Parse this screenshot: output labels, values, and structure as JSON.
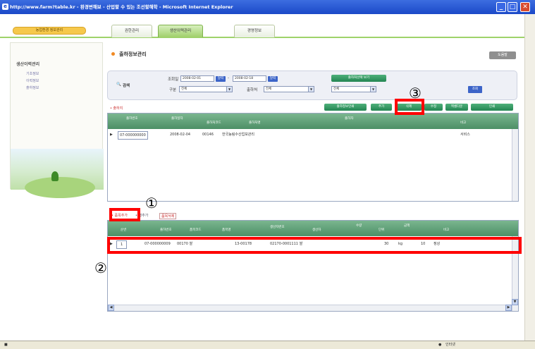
{
  "window": {
    "title": "http://www.farm?table.kr - 환경변해보 - 산업할 수 있는 조선할해학 - Microsoft Internet Explorer",
    "min": "_",
    "max": "□",
    "close": "✕"
  },
  "app": {
    "logo_text": "농업환경 정보관리",
    "tabs": [
      "권한관리",
      "생산이력관리",
      "경영정보"
    ],
    "active_tab_index": 1
  },
  "sidebar": {
    "heading": "생산이력관리",
    "items": [
      "기초정보",
      "이력정보",
      "출하정보"
    ]
  },
  "main": {
    "title": "출하정보관리",
    "top_right_button": "도움말",
    "search": {
      "label": "검색",
      "date_label": "조회일",
      "date_from": "2008-02-01",
      "date_to": "2008-02-18",
      "cal_btn": "달력",
      "type_label": "구분",
      "type_value": "전체",
      "dest_label": "출하처",
      "dest_value": "전체",
      "cond_value": "전체",
      "green_btn": "출하처선택 보기",
      "query_btn": "조회"
    },
    "toolbar": {
      "left_link": "• 출하지",
      "buttons": [
        "출하정보인쇄",
        "추가",
        "삭제",
        "수정",
        "엑셀다운",
        "인쇄"
      ]
    },
    "upper_table": {
      "headers": [
        "",
        "출하번호",
        "출하일자",
        "출하처코드",
        "출하처명",
        "출하자",
        "비고"
      ],
      "rows": [
        [
          "▶",
          "07-000000000",
          "2008-02-04",
          "00146",
          "한국농림수산업보관리",
          "",
          "서비스"
        ]
      ]
    },
    "lower_toolbar": {
      "links": [
        "• 품목추가",
        "• 행추가",
        "품목삭제"
      ]
    },
    "lower_table": {
      "headers": [
        "",
        "순번",
        "출하번호",
        "품목코드",
        "품목명",
        "생산자번호",
        "생산자",
        "수량",
        "단위",
        "금액",
        "비고"
      ],
      "rows": [
        [
          "▶",
          "1",
          "07-000000009",
          "00170 쌀",
          "",
          "13-00178",
          "02170-0001111 쌀",
          "30",
          "kg",
          "10",
          "정상"
        ]
      ]
    }
  },
  "annotations": {
    "one": "①",
    "two": "②",
    "three": "③"
  },
  "statusbar": {
    "text": "인터넷"
  },
  "colors": {
    "titlebar": "#1b49c8",
    "header_green": "#4d8f66",
    "highlight_red": "#ff0000"
  }
}
